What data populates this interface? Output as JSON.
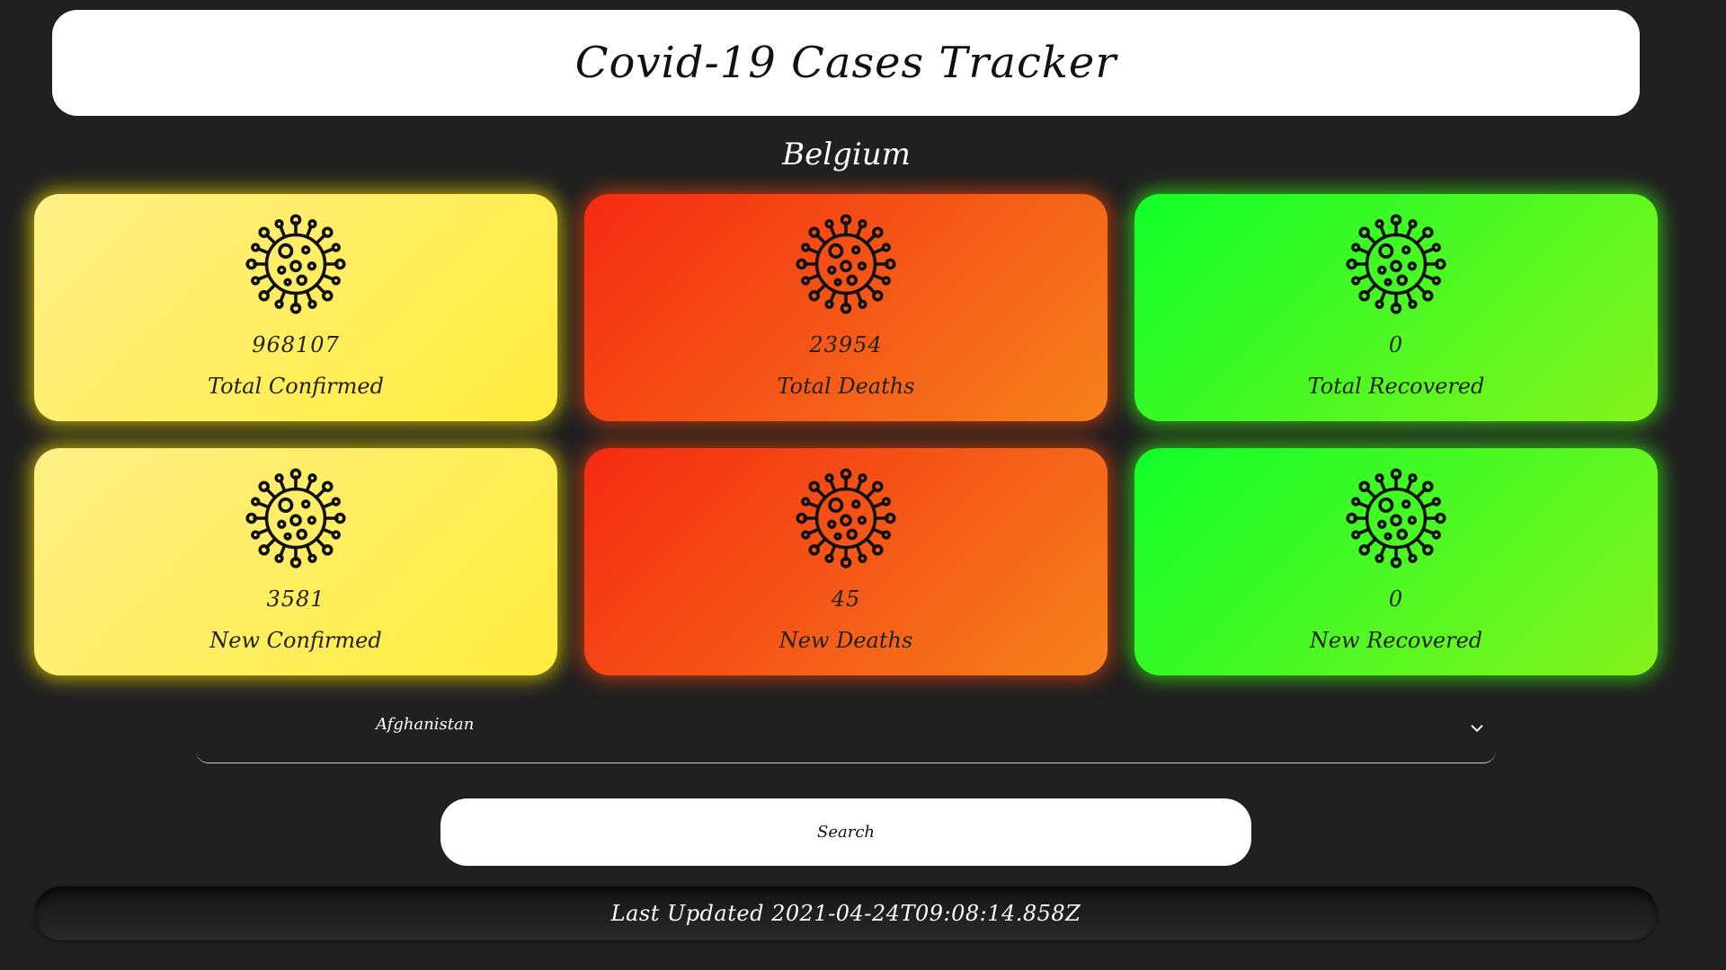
{
  "header": {
    "title": "Covid-19 Cases Tracker"
  },
  "country": "Belgium",
  "cards": [
    {
      "value": "968107",
      "label": "Total Confirmed",
      "color": "yellow",
      "icon": "virus-icon"
    },
    {
      "value": "23954",
      "label": "Total Deaths",
      "color": "red",
      "icon": "virus-icon"
    },
    {
      "value": "0",
      "label": "Total Recovered",
      "color": "green",
      "icon": "virus-icon"
    },
    {
      "value": "3581",
      "label": "New Confirmed",
      "color": "yellow",
      "icon": "virus-icon"
    },
    {
      "value": "45",
      "label": "New Deaths",
      "color": "red",
      "icon": "virus-icon"
    },
    {
      "value": "0",
      "label": "New Recovered",
      "color": "green",
      "icon": "virus-icon"
    }
  ],
  "country_select": {
    "selected": "Afghanistan",
    "icon": "chevron-down-icon"
  },
  "search_button": {
    "label": "Search"
  },
  "footer": {
    "last_updated": "Last Updated 2021-04-24T09:08:14.858Z"
  },
  "colors": {
    "background": "#202020",
    "yellow": "#ffec3c",
    "red": "#f52a12",
    "green": "#10ff2a"
  }
}
